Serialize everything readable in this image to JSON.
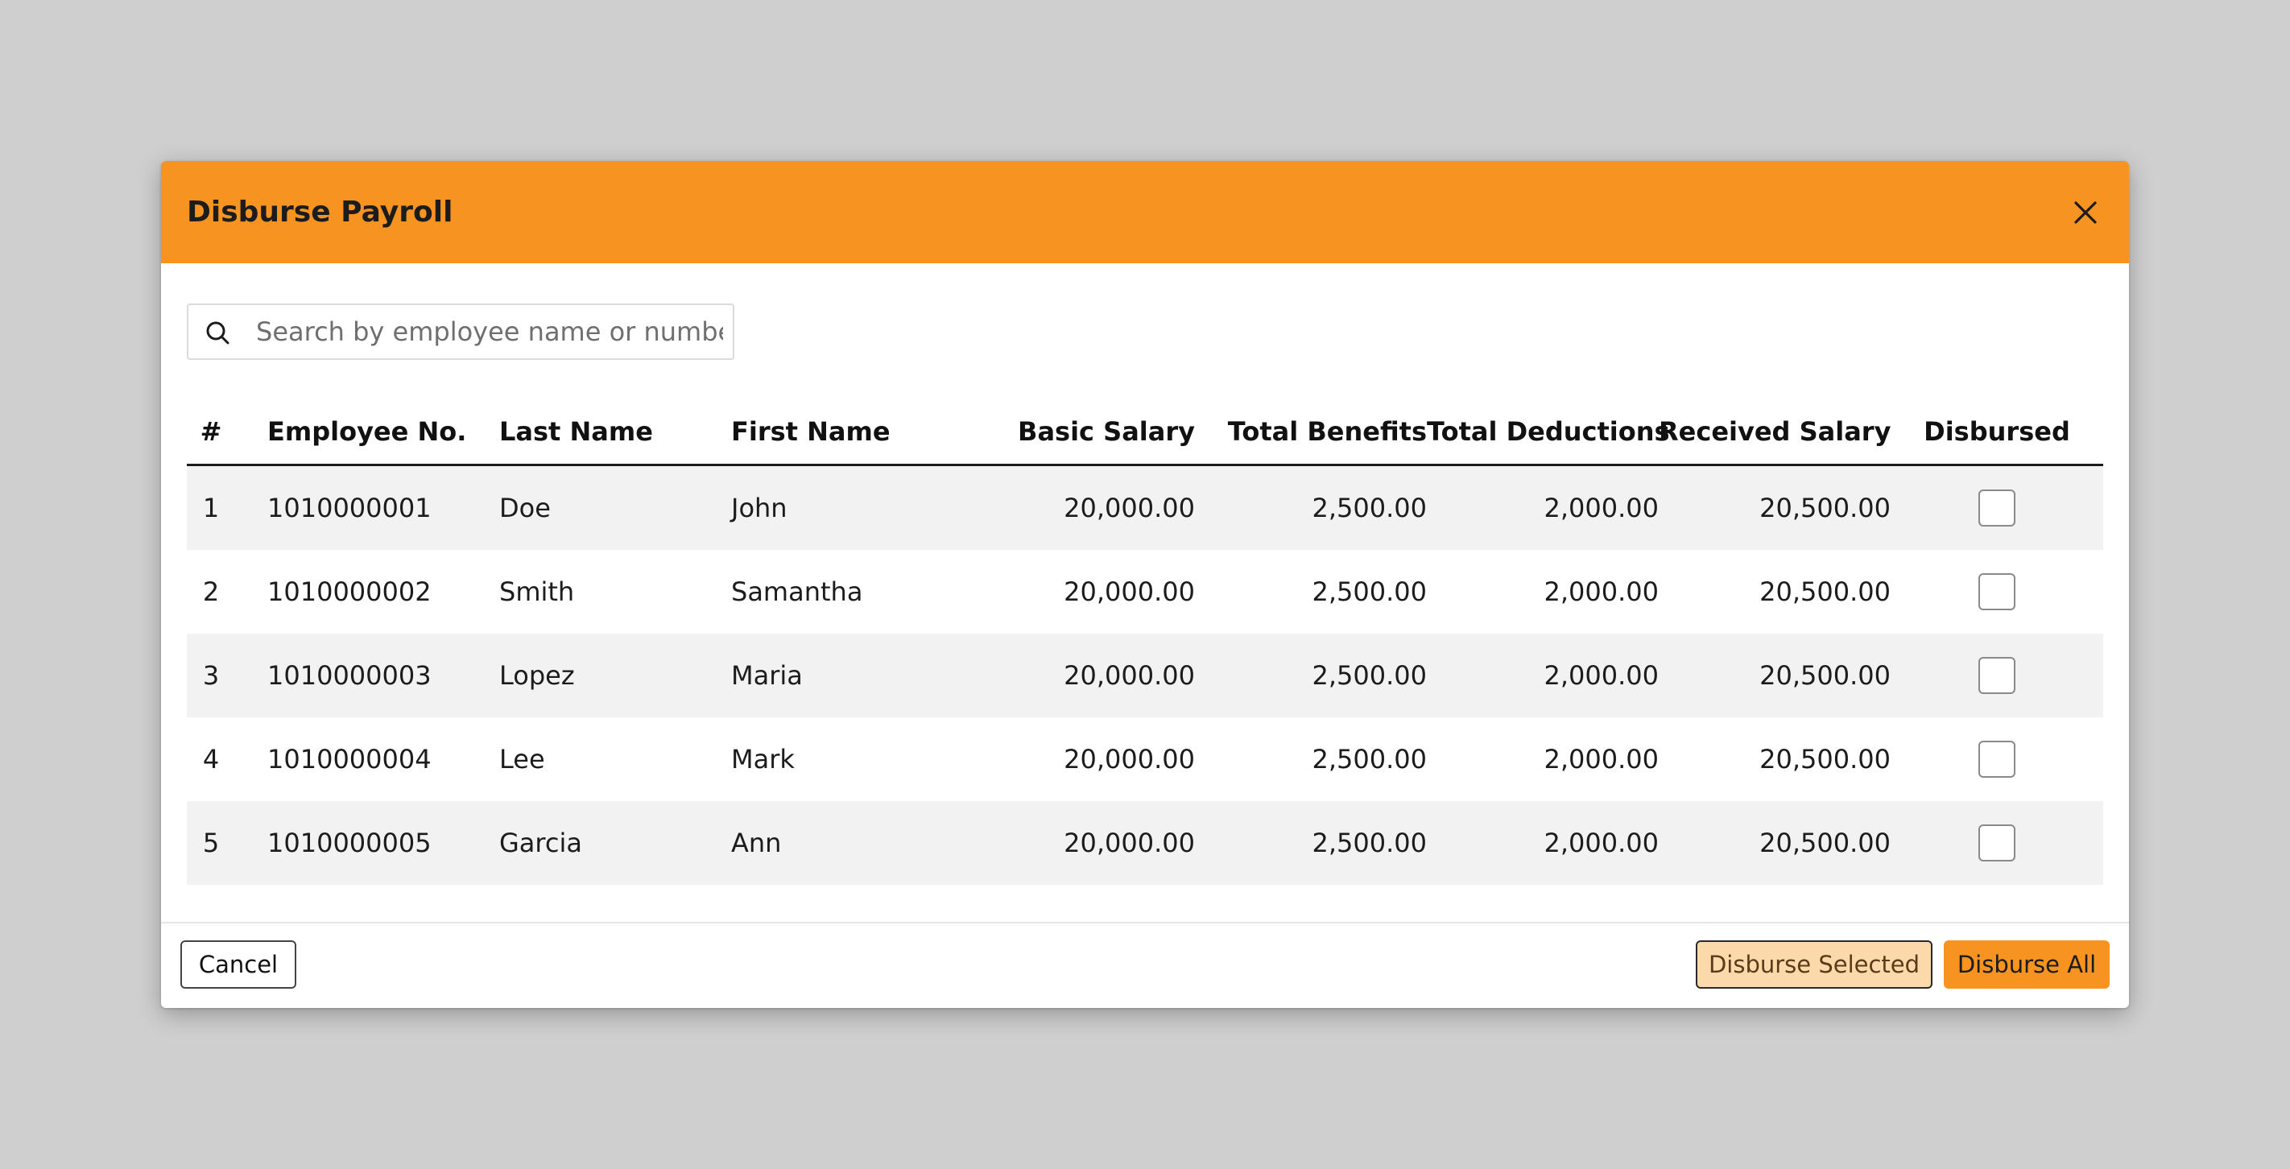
{
  "modal": {
    "title": "Disburse Payroll",
    "close_icon": "close-icon"
  },
  "search": {
    "placeholder": "Search by employee name or number",
    "value": "",
    "icon": "search-icon"
  },
  "table": {
    "headers": {
      "num": "#",
      "employee_no": "Employee No.",
      "last_name": "Last Name",
      "first_name": "First Name",
      "basic_salary": "Basic Salary",
      "total_benefits": "Total Benefits",
      "total_deductions": "Total Deductions",
      "received_salary": "Received Salary",
      "disbursed": "Disbursed"
    },
    "rows": [
      {
        "num": "1",
        "employee_no": "1010000001",
        "last_name": "Doe",
        "first_name": "John",
        "basic_salary": "20,000.00",
        "total_benefits": "2,500.00",
        "total_deductions": "2,000.00",
        "received_salary": "20,500.00",
        "disbursed": false
      },
      {
        "num": "2",
        "employee_no": "1010000002",
        "last_name": "Smith",
        "first_name": "Samantha",
        "basic_salary": "20,000.00",
        "total_benefits": "2,500.00",
        "total_deductions": "2,000.00",
        "received_salary": "20,500.00",
        "disbursed": false
      },
      {
        "num": "3",
        "employee_no": "1010000003",
        "last_name": "Lopez",
        "first_name": "Maria",
        "basic_salary": "20,000.00",
        "total_benefits": "2,500.00",
        "total_deductions": "2,000.00",
        "received_salary": "20,500.00",
        "disbursed": false
      },
      {
        "num": "4",
        "employee_no": "1010000004",
        "last_name": "Lee",
        "first_name": "Mark",
        "basic_salary": "20,000.00",
        "total_benefits": "2,500.00",
        "total_deductions": "2,000.00",
        "received_salary": "20,500.00",
        "disbursed": false
      },
      {
        "num": "5",
        "employee_no": "1010000005",
        "last_name": "Garcia",
        "first_name": "Ann",
        "basic_salary": "20,000.00",
        "total_benefits": "2,500.00",
        "total_deductions": "2,000.00",
        "received_salary": "20,500.00",
        "disbursed": false
      }
    ]
  },
  "footer": {
    "cancel_label": "Cancel",
    "disburse_selected_label": "Disburse Selected",
    "disburse_all_label": "Disburse All"
  },
  "colors": {
    "accent": "#f79321",
    "accent_light": "#fcd9ab",
    "backdrop": "#cfcfcf",
    "row_alt": "#f2f2f2"
  }
}
